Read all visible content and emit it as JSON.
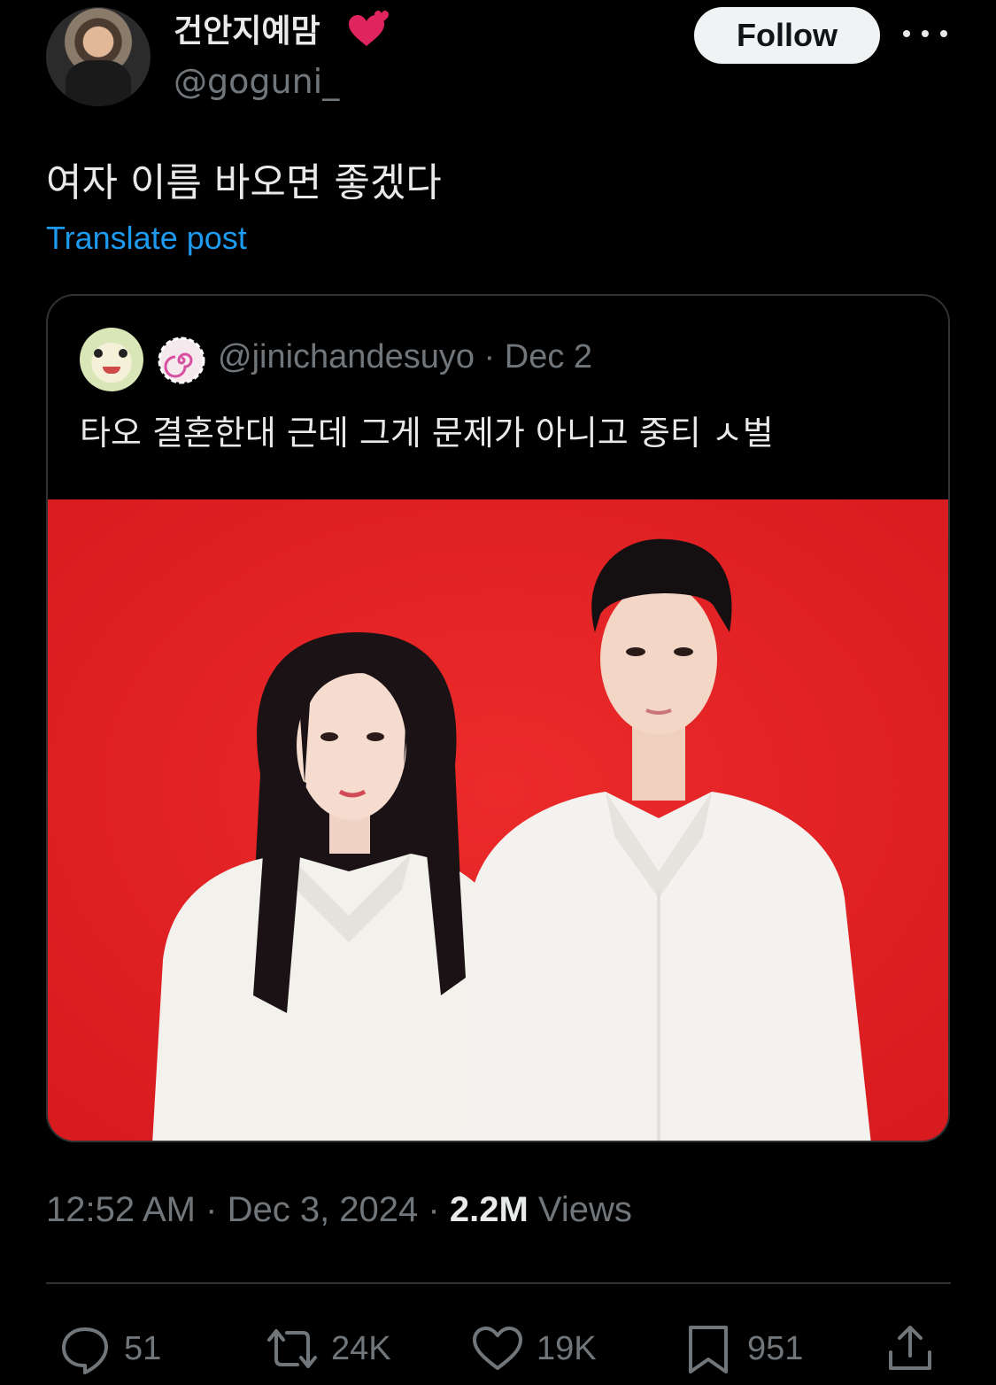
{
  "author": {
    "display_name": "건안지예맘",
    "handle": "@goguni_",
    "emoji_icon": "two-hearts-icon"
  },
  "follow_label": "Follow",
  "post": {
    "text": "여자 이름 바오면 좋겠다",
    "translate_label": "Translate post"
  },
  "quoted": {
    "handle": "@jinichandesuyo",
    "date": "Dec 2",
    "text": "타오 결혼한대 근데 그게 문제가 아니고 중티 ㅅ벌",
    "badge_icon": "spiral-icon",
    "image_alt": "Couple in white shirts against red background"
  },
  "meta": {
    "time": "12:52 AM",
    "date": "Dec 3, 2024",
    "views_count": "2.2M",
    "views_label": "Views"
  },
  "actions": {
    "replies": "51",
    "reposts": "24K",
    "likes": "19K",
    "bookmarks": "951"
  },
  "colors": {
    "background": "#000000",
    "accent": "#1d9bf0",
    "muted": "#71767b",
    "photo_bg": "#e01f22"
  }
}
